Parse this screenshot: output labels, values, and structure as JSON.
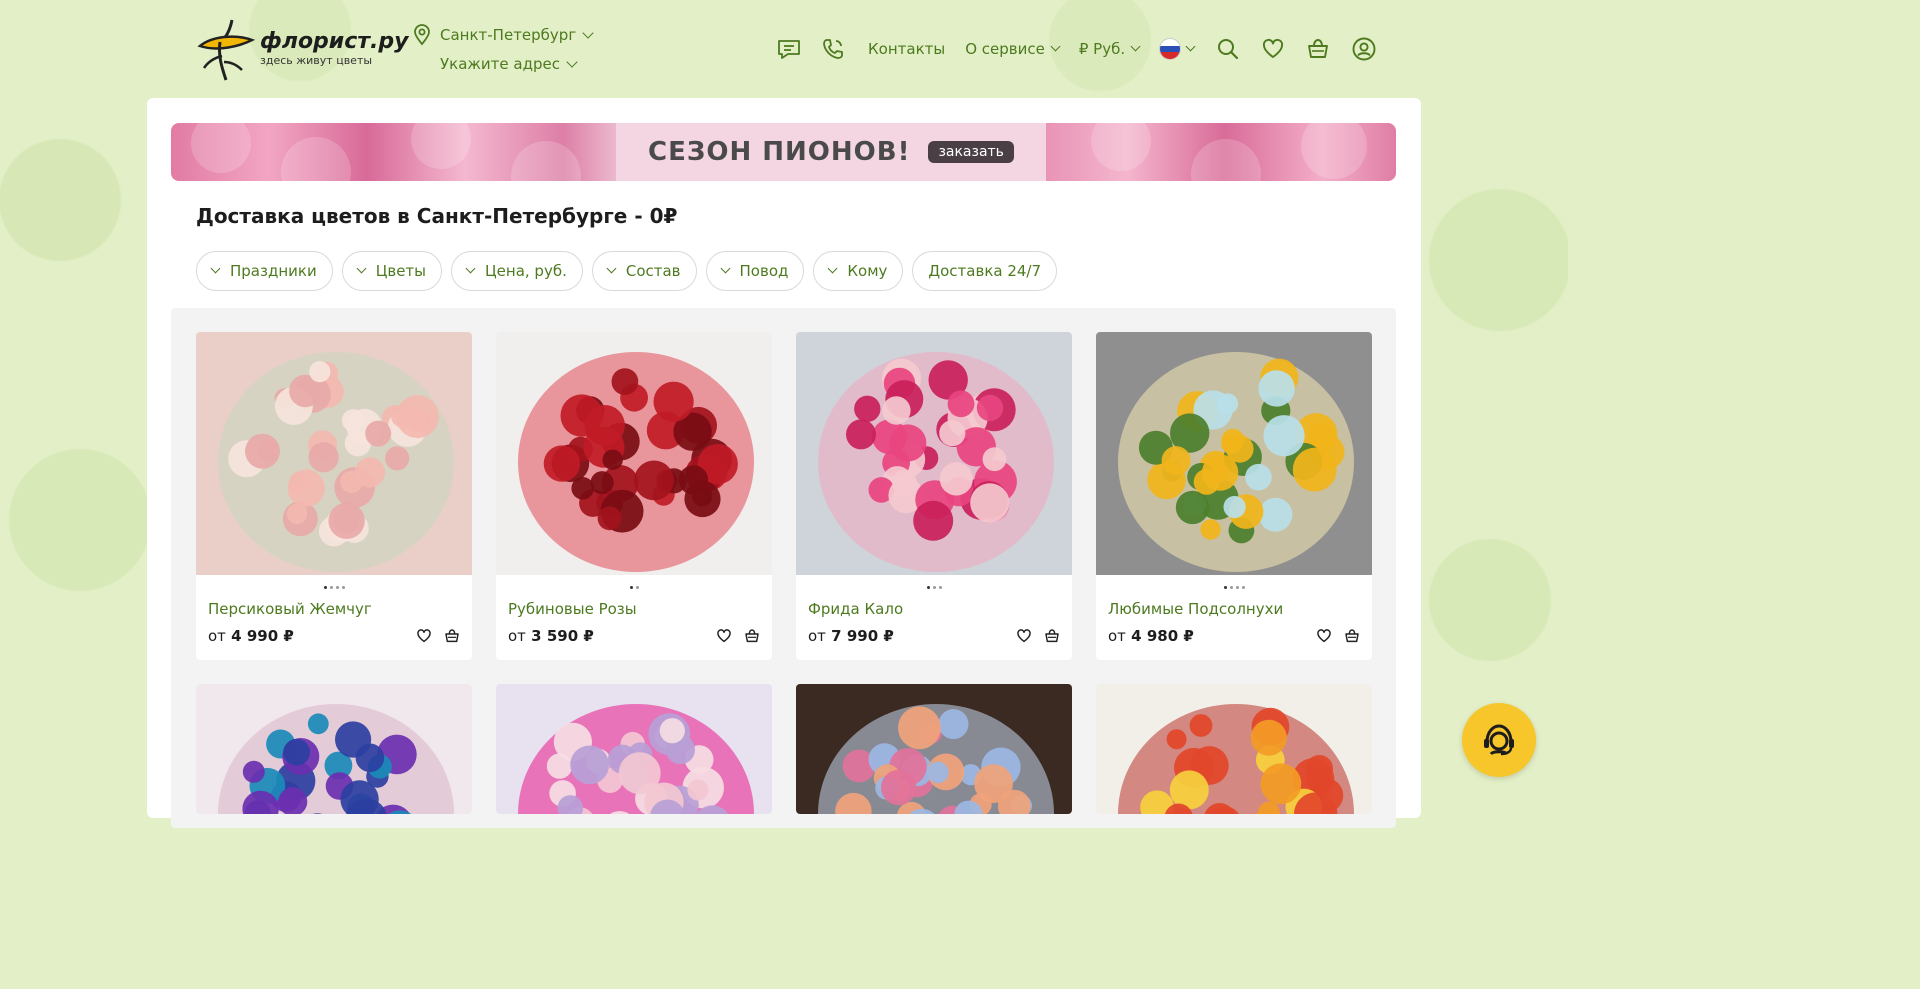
{
  "header": {
    "logo_name": "флорист.ру",
    "logo_slogan": "здесь живут цветы",
    "city": "Санкт-Петербург",
    "address": "Укажите адрес",
    "nav": {
      "contacts": "Контакты",
      "about": "О сервисе",
      "currency": "₽ Руб."
    },
    "icons": [
      "chat-icon",
      "phone-icon",
      "flag-ru-icon",
      "search-icon",
      "heart-icon",
      "basket-icon",
      "user-icon"
    ]
  },
  "promo": {
    "headline": "СЕЗОН ПИОНОВ!",
    "button": "заказать"
  },
  "page_title": "Доставка цветов в Санкт-Петербурге - 0₽",
  "filters": [
    {
      "label": "Праздники",
      "dropdown": true
    },
    {
      "label": "Цветы",
      "dropdown": true
    },
    {
      "label": "Цена, руб.",
      "dropdown": true
    },
    {
      "label": "Состав",
      "dropdown": true
    },
    {
      "label": "Повод",
      "dropdown": true
    },
    {
      "label": "Кому",
      "dropdown": true
    },
    {
      "label": "Доставка 24/7",
      "dropdown": false
    }
  ],
  "products": [
    {
      "name": "Персиковый Жемчуг",
      "price_from": "от",
      "price": "4 990 ₽",
      "photos": 4,
      "colors": [
        "#e9cfc7",
        "#f3b9b0",
        "#f6e4dc",
        "#e7a9a8",
        "#c8d7bf"
      ]
    },
    {
      "name": "Рубиновые Розы",
      "price_from": "от",
      "price": "3 590 ₽",
      "photos": 2,
      "colors": [
        "#f1efee",
        "#a3121c",
        "#c01b26",
        "#7a0c13",
        "#e04a5a"
      ]
    },
    {
      "name": "Фрида Кало",
      "price_from": "от",
      "price": "7 990 ₽",
      "photos": 3,
      "colors": [
        "#cfd3da",
        "#e8447f",
        "#f4c9cf",
        "#c91f5a",
        "#f3a8bd"
      ]
    },
    {
      "name": "Любимые Подсолнухи",
      "price_from": "от",
      "price": "4 980 ₽",
      "photos": 4,
      "colors": [
        "#8f8f8f",
        "#f1b51a",
        "#b9dfe9",
        "#4c7f2c",
        "#f7e9b5"
      ]
    }
  ],
  "products_row2": [
    {
      "colors": [
        "#f1e8ee",
        "#2b3fa1",
        "#6a2fb0",
        "#1a8bb8",
        "#d9b3c7"
      ]
    },
    {
      "colors": [
        "#e8e1ef",
        "#b7a0d6",
        "#f2c7d1",
        "#f5dde3",
        "#e81a8c"
      ]
    },
    {
      "colors": [
        "#3a2a22",
        "#e2729a",
        "#9bb7e3",
        "#f0a37a",
        "#c9d9f0"
      ]
    },
    {
      "colors": [
        "#f2efe9",
        "#e2462a",
        "#f39b25",
        "#f6d03c",
        "#b9332b"
      ]
    }
  ],
  "help_button": "support-icon"
}
